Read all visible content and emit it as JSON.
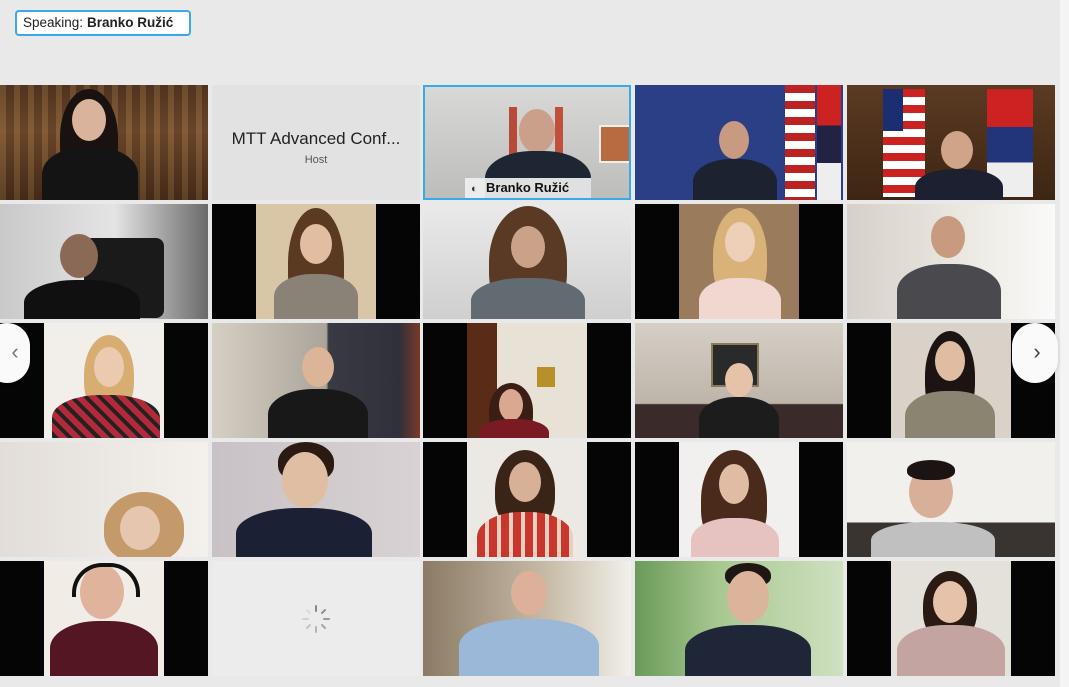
{
  "speaking": {
    "prefix": "Speaking:",
    "name": "Branko Ružić"
  },
  "host_tile": {
    "name": "MTT Advanced Conf...",
    "role": "Host"
  },
  "active_speaker": {
    "name": "Branko Ružić",
    "mic_icon": "microphone-icon"
  },
  "navigation": {
    "prev_glyph": "‹",
    "next_glyph": "›"
  },
  "colors": {
    "active_border": "#3aa9ec",
    "background": "#e9e9e9"
  }
}
